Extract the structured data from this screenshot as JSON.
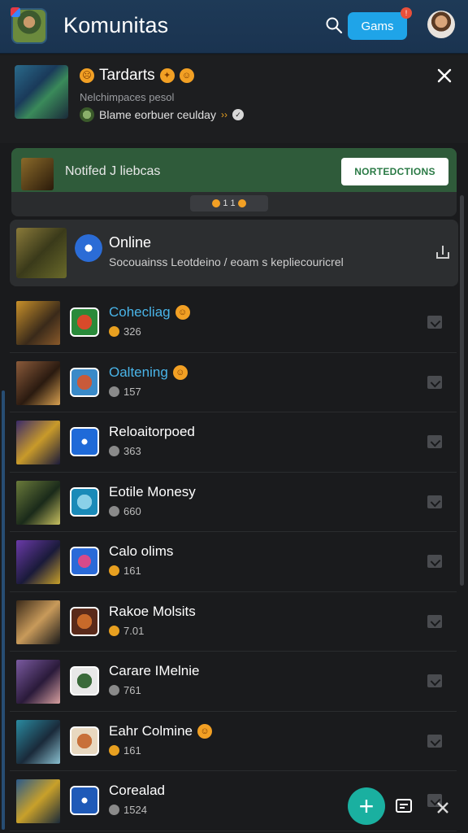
{
  "header": {
    "title": "Komunitas",
    "games_label": "Gams",
    "games_badge": "!"
  },
  "notification": {
    "title": "Tardarts",
    "subtitle": "Nelchimpaces pesol",
    "line": "Blame eorbuer ceulday",
    "arrow": "››"
  },
  "banner": {
    "text": "Notifed J liebcas",
    "button_label": "NORTEDCTIONS",
    "pill_text": "1 1"
  },
  "online": {
    "title": "Online",
    "subtitle": "Socouainss Leotdeino / eoam s kepliecouricrel"
  },
  "communities": [
    {
      "name": "Cohecliag",
      "count": "326",
      "blue": true,
      "emoji": true,
      "dot": "o"
    },
    {
      "name": "Oaltening",
      "count": "157",
      "blue": true,
      "emoji": true,
      "dot": "g"
    },
    {
      "name": "Reloaitorpoed",
      "count": "363",
      "blue": false,
      "emoji": false,
      "dot": "g"
    },
    {
      "name": "Eotile Monesy",
      "count": "660",
      "blue": false,
      "emoji": false,
      "dot": "g"
    },
    {
      "name": "Calo olims",
      "count": "161",
      "blue": false,
      "emoji": false,
      "dot": "o"
    },
    {
      "name": "Rakoe Molsits",
      "count": "7.01",
      "blue": false,
      "emoji": false,
      "dot": "o"
    },
    {
      "name": "Carare IMelnie",
      "count": "761",
      "blue": false,
      "emoji": false,
      "dot": "g"
    },
    {
      "name": "Eahr Colmine",
      "count": "161",
      "blue": false,
      "emoji": true,
      "dot": "o"
    },
    {
      "name": "Corealad",
      "count": "1524",
      "blue": false,
      "emoji": false,
      "dot": "g"
    }
  ],
  "colors": {
    "accent": "#1fa4e8",
    "banner_green": "#2f5b3a",
    "fab": "#1ab0a0",
    "link_blue": "#49b4e8"
  },
  "icons": {
    "search": "search-icon",
    "close": "close-icon",
    "share": "share-icon",
    "add": "plus-icon",
    "chat": "chat-icon"
  }
}
